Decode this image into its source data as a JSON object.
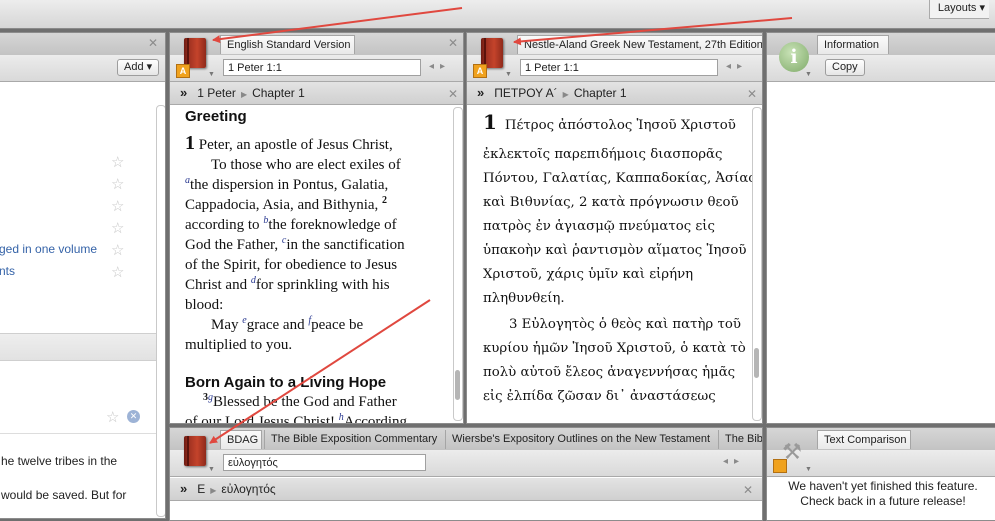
{
  "topbar": {
    "layouts_label": "Layouts ▾"
  },
  "left_panel": {
    "add_button": "Add ▾",
    "resource_text_1": "ged in one volume",
    "resource_text_2": "nts",
    "text_line_1": "he twelve tribes in the",
    "text_line_2": "would be saved. But for"
  },
  "esv_panel": {
    "tab_title": "English Standard Version",
    "reference": "1 Peter 1:1",
    "breadcrumb": {
      "book": "1 Peter",
      "chapter": "Chapter 1"
    },
    "heading": "Greeting",
    "lines": [
      {
        "chapter": "1",
        "text": " Peter, an apostle of Jesus Christ,"
      },
      {
        "text": "To those who are elect exiles of"
      },
      {
        "fn": "a",
        "text": "the dispersion in Pontus, Galatia,"
      },
      {
        "text": "Cappadocia, Asia, and Bithynia, ",
        "verse": "2"
      },
      {
        "text": "according to ",
        "fn": "b",
        "text2": "the foreknowledge of"
      },
      {
        "text": "God the Father, ",
        "fn": "c",
        "text2": "in the sanctification"
      },
      {
        "text": "of the Spirit, for obedience to Jesus"
      },
      {
        "text": "Christ and ",
        "fn": "d",
        "text2": "for sprinkling with his"
      },
      {
        "text": "blood:"
      },
      {
        "text": "May ",
        "fn": "e",
        "text2": "grace and ",
        "fn2": "f",
        "text3": "peace be"
      },
      {
        "text": "multiplied to you."
      }
    ],
    "heading2": "Born Again to a Living Hope",
    "line_after": {
      "verse": "3",
      "fn": "g",
      "text": "Blessed be the God and Father"
    },
    "line_after2": {
      "text": "of our Lord Jesus Christ! ",
      "fn": "h",
      "text2": "According"
    }
  },
  "greek_panel": {
    "tab_title": "Nestle-Aland Greek New Testament, 27th Edition",
    "reference": "1 Peter 1:1",
    "breadcrumb": {
      "book": "ΠΕΤΡΟΥ Α´",
      "chapter": "Chapter 1"
    },
    "chapter_num": "1",
    "lines": [
      "Πέτρος ἀπόστολος Ἰησοῦ Χριστοῦ",
      "ἐκλεκτοῖς παρεπιδήμοις διασπορᾶς",
      "Πόντου, Γαλατίας, Καππαδοκίας, Ἀσίας",
      "καὶ Βιθυνίας, 2 κατὰ πρόγνωσιν θεοῦ",
      "πατρὸς ἐν ἁγιασμῷ πνεύματος εἰς",
      "ὑπακοὴν καὶ ῥαντισμὸν αἵματος Ἰησοῦ",
      "Χριστοῦ, χάρις ὑμῖν καὶ εἰρήνη",
      "πληθυνθείη.",
      "3 Εὐλογητὸς ὁ θεὸς καὶ πατὴρ τοῦ",
      "κυρίου ἡμῶν Ἰησοῦ Χριστοῦ, ὁ κατὰ τὸ",
      "πολὺ αὐτοῦ ἔλεος ἀναγεννήσας ἡμᾶς",
      "εἰς ἐλπίδα ζῶσαν δι᾽ ἀναστάσεως"
    ]
  },
  "info_panel": {
    "tab_title": "Information",
    "copy_button": "Copy"
  },
  "bdag_panel": {
    "tabs": [
      "BDAG",
      "The Bible Exposition Commentary",
      "Wiersbe's Expository Outlines on the New Testament",
      "The Bib"
    ],
    "search_value": "εὐλογητός",
    "breadcrumb": {
      "letter": "E",
      "entry": "εὐλογητός"
    }
  },
  "text_comparison_panel": {
    "tab_title": "Text Comparison",
    "message_line_1": "We haven't yet finished this feature.",
    "message_line_2": "Check back in a future release!"
  },
  "colors": {
    "annotation_arrow": "#e0483f",
    "footnote": "#2b3a91",
    "link_blue": "#3563a8"
  },
  "icons": {
    "resource": "red-book-icon",
    "info": "info-icon",
    "close": "close-icon",
    "star": "star-icon"
  }
}
